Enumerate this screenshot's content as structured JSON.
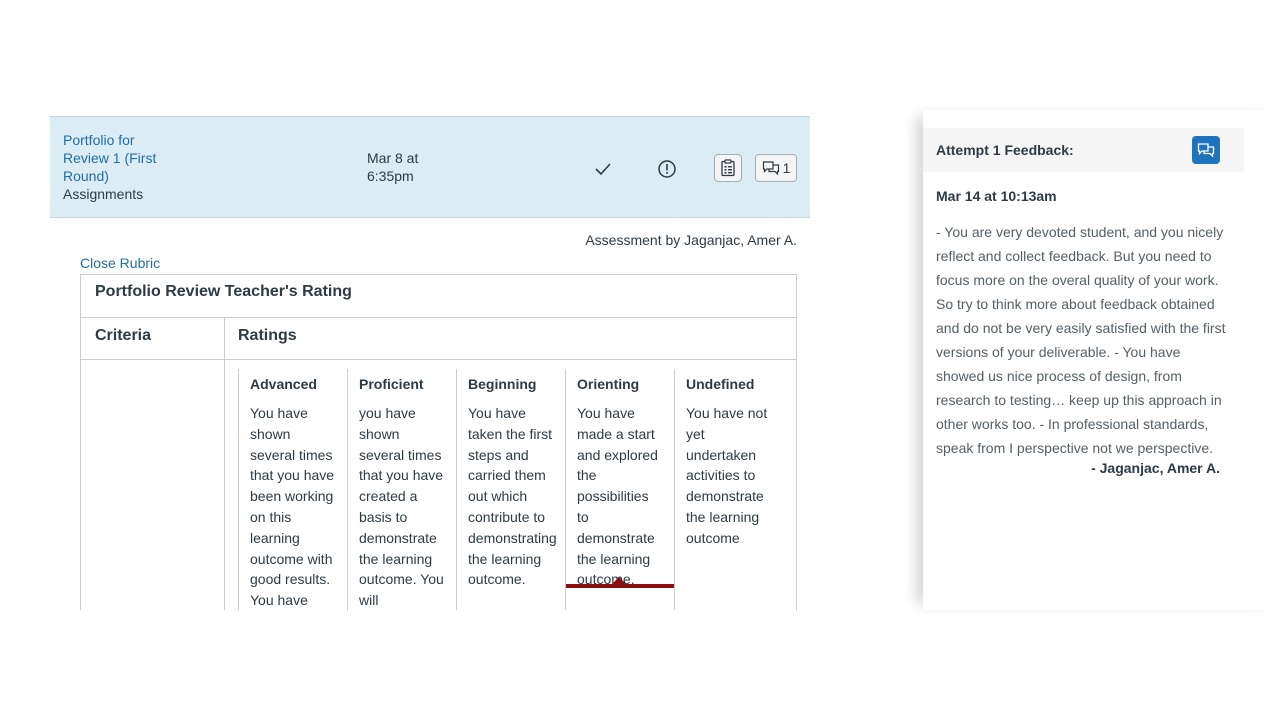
{
  "assignment": {
    "name": "Portfolio for Review 1 (First Round)",
    "type": "Assignments",
    "date": "Mar 8 at 6:35pm",
    "comment_count": "1"
  },
  "assessment_by": "Assessment by Jaganjac, Amer A.",
  "close_rubric_label": "Close Rubric",
  "rubric": {
    "title": "Portfolio Review Teacher's Rating",
    "criteria_header": "Criteria",
    "ratings_header": "Ratings",
    "ratings": [
      {
        "title": "Advanced",
        "description": "You have shown several times that you have been working on this learning outcome with good results. You have performed"
      },
      {
        "title": "Proficient",
        "description": "you have shown several times that you have created a basis to demonstrate the learning outcome. You will demonstrate"
      },
      {
        "title": "Beginning",
        "description": "You have taken the first steps and carried them out which contribute to demonstrating the learning outcome."
      },
      {
        "title": "Orienting",
        "description": "You have made a start and explored the possibilities to demonstrate the learning outcome."
      },
      {
        "title": "Undefined",
        "description": "You have not yet undertaken activities to demonstrate the learning outcome"
      }
    ],
    "selected_rating": "Orienting"
  },
  "feedback": {
    "header": "Attempt 1 Feedback:",
    "date": "Mar 14 at 10:13am",
    "text": "- You are very devoted student, and you nicely reflect and collect feedback. But you need to focus more on the overal quality of your work. So try to think more about feedback obtained and do not be very easily satisfied with the first versions of your deliverable. - You have showed us nice process of design, from research to testing… keep up this approach in other works too. - In professional standards, speak from I perspective not we perspective.",
    "author": "- Jaganjac, Amer A."
  },
  "icons": {
    "check": "checkmark-icon",
    "warning": "exclamation-circle-icon",
    "rubric": "rubric-clipboard-icon",
    "comments": "comments-icon",
    "feedback_button": "comments-icon"
  },
  "colors": {
    "row_bg": "#dbecf5",
    "link": "#1f6ea8",
    "selected_bar": "#8b0f0f",
    "feedback_button": "#1e73be"
  }
}
